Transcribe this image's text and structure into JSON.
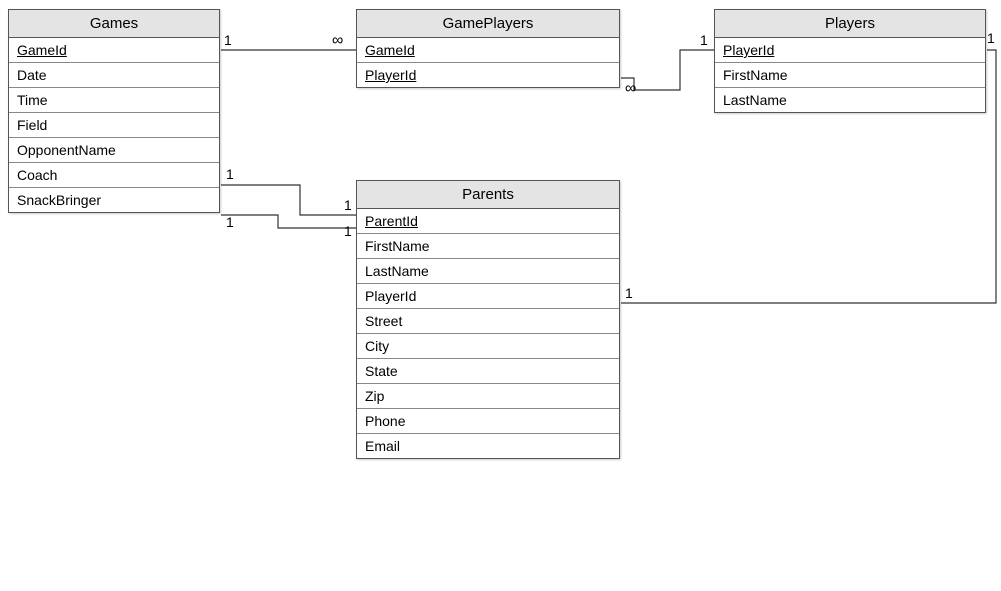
{
  "entities": {
    "games": {
      "title": "Games",
      "fields": [
        "GameId",
        "Date",
        "Time",
        "Field",
        "OpponentName",
        "Coach",
        "SnackBringer"
      ],
      "primaryKeys": [
        "GameId"
      ]
    },
    "gamePlayers": {
      "title": "GamePlayers",
      "fields": [
        "GameId",
        "PlayerId"
      ],
      "primaryKeys": [
        "GameId",
        "PlayerId"
      ]
    },
    "players": {
      "title": "Players",
      "fields": [
        "PlayerId",
        "FirstName",
        "LastName"
      ],
      "primaryKeys": [
        "PlayerId"
      ]
    },
    "parents": {
      "title": "Parents",
      "fields": [
        "ParentId",
        "FirstName",
        "LastName",
        "PlayerId",
        "Street",
        "City",
        "State",
        "Zip",
        "Phone",
        "Email"
      ],
      "primaryKeys": [
        "ParentId"
      ]
    }
  },
  "relationships": [
    {
      "from": "Games.GameId",
      "to": "GamePlayers.GameId",
      "cardFrom": "1",
      "cardTo": "∞"
    },
    {
      "from": "Players.PlayerId",
      "to": "GamePlayers.PlayerId",
      "cardFrom": "1",
      "cardTo": "∞"
    },
    {
      "from": "Games.Coach",
      "to": "Parents.ParentId",
      "cardFrom": "1",
      "cardTo": "1"
    },
    {
      "from": "Games.SnackBringer",
      "to": "Parents.ParentId",
      "cardFrom": "1",
      "cardTo": "1"
    },
    {
      "from": "Players.PlayerId",
      "to": "Parents.PlayerId",
      "cardFrom": "1",
      "cardTo": "1"
    }
  ],
  "cardinality": {
    "one": "1",
    "many": "∞"
  }
}
